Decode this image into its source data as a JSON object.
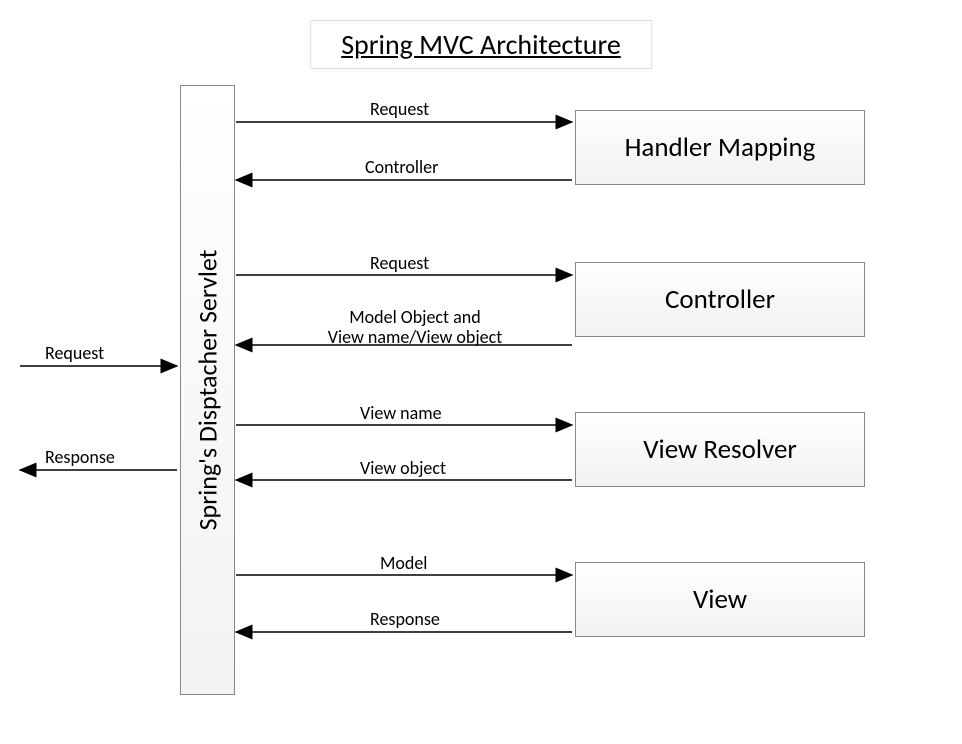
{
  "title": "Spring MVC Architecture",
  "dispatcher": "Spring's Disptacher Servlet",
  "components": {
    "handlerMapping": "Handler Mapping",
    "controller": "Controller",
    "viewResolver": "View Resolver",
    "view": "View"
  },
  "external": {
    "request": "Request",
    "response": "Response"
  },
  "flows": {
    "hm_req": "Request",
    "hm_ctrl": "Controller",
    "ctrl_req": "Request",
    "ctrl_model_l1": "Model Object and",
    "ctrl_model_l2": "View name/View object",
    "vr_name": "View name",
    "vr_obj": "View object",
    "v_model": "Model",
    "v_resp": "Response"
  }
}
